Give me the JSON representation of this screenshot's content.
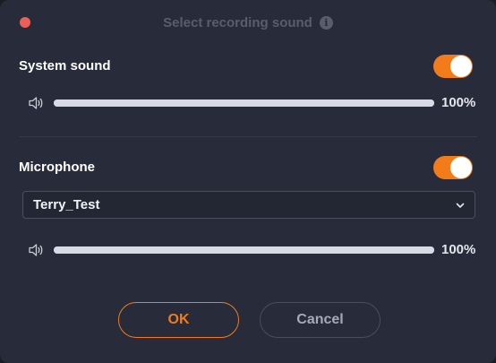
{
  "window": {
    "title": "Select recording sound",
    "accent_color": "#f27b1a",
    "close_color": "#ec5f57"
  },
  "system_sound": {
    "label": "System sound",
    "enabled": true,
    "volume_text": "100%",
    "volume_level": 1.0
  },
  "microphone": {
    "label": "Microphone",
    "enabled": true,
    "device_selected": "Terry_Test",
    "volume_text": "100%",
    "volume_level": 1.0
  },
  "buttons": {
    "ok_label": "OK",
    "cancel_label": "Cancel"
  },
  "icons": {
    "close": "close-dot",
    "info": "info-icon",
    "speaker": "speaker-icon",
    "dropdown": "chevron-down-icon"
  }
}
